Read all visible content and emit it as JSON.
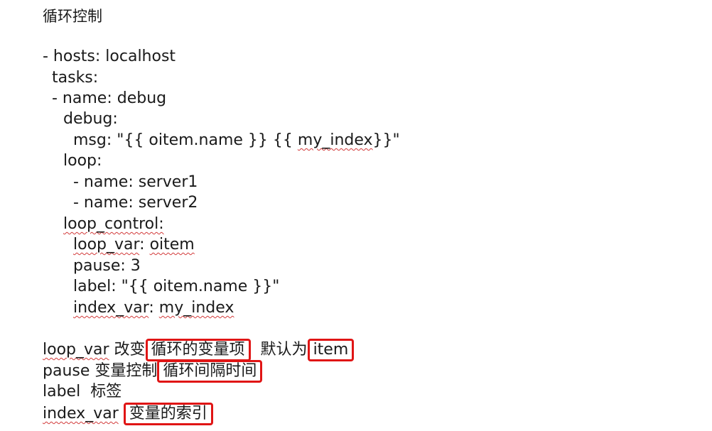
{
  "title": "循环控制",
  "code": {
    "line1": "- hosts: localhost",
    "line2": "tasks:",
    "line3": "- name: debug",
    "line4": "debug:",
    "line5_pre": "msg: \"{{ oitem.name }} {{ ",
    "line5_var": "my_index",
    "line5_post": "}}\"",
    "line6": "loop:",
    "line7": "- name: server1",
    "line8": "- name: server2",
    "line9": "loop_control:",
    "line10_key": "loop_var",
    "line10_sep": ": ",
    "line10_val": "oitem",
    "line11": "pause: 3",
    "line12": "label: \"{{ oitem.name }}\"",
    "line13_key": "index_var",
    "line13_sep": ": ",
    "line13_val": "my_index"
  },
  "notes": {
    "n1_key": "loop_var",
    "n1_text": " 改变",
    "n1_box": "循环的变量项",
    "n1_mid": "  默认为",
    "n1_box2": "item",
    "n2_key": "pause",
    "n2_text": " 变量控制",
    "n2_box": "循环间隔时间",
    "n3_key": "label",
    "n3_text": "  标签",
    "n4_key": "index_var",
    "n4_text": " ",
    "n4_box": "变量的索引"
  },
  "colors": {
    "box_border": "#e01515",
    "spell_underline": "#d23a3a",
    "text": "#1a1a1a"
  }
}
